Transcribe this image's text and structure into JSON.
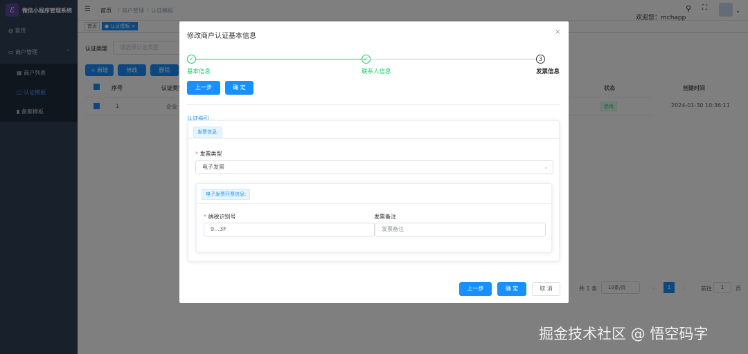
{
  "app": {
    "title": "微信小程序管理系统",
    "logo_icon": "logo-icon"
  },
  "sidebar": {
    "items": [
      {
        "label": "首页"
      },
      {
        "label": "商户管理"
      },
      {
        "label": "商户列表"
      },
      {
        "label": "认证模板"
      },
      {
        "label": "备案模板"
      }
    ]
  },
  "header": {
    "breadcrumb": [
      "首页",
      "商户管理",
      "认证模板"
    ],
    "welcome": "欢迎您：mchapp"
  },
  "tags": {
    "home": "首页",
    "active": "认证模板"
  },
  "page": {
    "filter_label": "认证类型",
    "filter_placeholder": "请选择认证类型",
    "buttons": {
      "add": "+ 新增",
      "edit": "修改",
      "delete": "删除"
    },
    "table": {
      "headers": [
        "序号",
        "认证类型",
        "状态",
        "创建时间"
      ],
      "rows": [
        {
          "index": "1",
          "type": "企业",
          "status": "启用",
          "created": "2024-01-30 10:36:11"
        }
      ]
    },
    "pagination": {
      "total": "共 1 条",
      "page_size": "10条/页",
      "current": "1",
      "goto_label": "前往",
      "goto_value": "1",
      "page_suffix": "页"
    }
  },
  "modal": {
    "title": "修改商户认证基本信息",
    "steps": [
      {
        "label": "基本信息",
        "status": "done"
      },
      {
        "label": "联系人信息",
        "status": "done"
      },
      {
        "label": "发票信息",
        "status": "active",
        "number": "3"
      }
    ],
    "prev_label": "上一步",
    "confirm_label": "确 定",
    "cancel_label": "取 消",
    "section_title": "认证指引",
    "invoice_tag": "发票信息:",
    "invoice_type_label": "发票类型",
    "invoice_type_value": "电子发票",
    "e_invoice_tag": "电子发票开票信息:",
    "tax_id_label": "纳税识别号",
    "tax_id_value": "9…3F",
    "remark_label": "发票备注",
    "remark_placeholder": "发票备注"
  },
  "watermark": "掘金技术社区 @ 悟空码字",
  "colors": {
    "primary": "#1890ff",
    "success": "#13ce66",
    "sidebar": "#304156"
  }
}
